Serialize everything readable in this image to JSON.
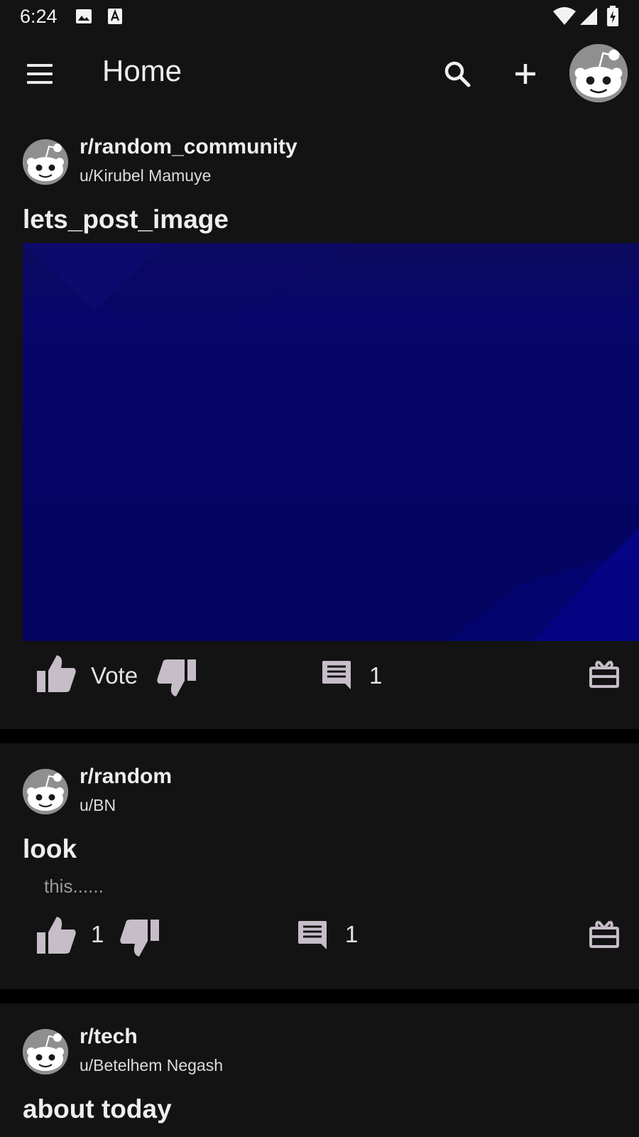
{
  "status_bar": {
    "time": "6:24"
  },
  "app_bar": {
    "title": "Home",
    "menu_icon": "hamburger-menu-icon",
    "search_icon": "search-icon",
    "create_icon": "plus-icon",
    "profile_icon": "reddit-avatar-icon"
  },
  "posts": [
    {
      "subreddit": "r/random_community",
      "user": "u/Kirubel Mamuye",
      "title": "lets_post_image",
      "has_image": true,
      "vote_label": "Vote",
      "comments": "1"
    },
    {
      "subreddit": "r/random",
      "user": "u/BN",
      "title": "look",
      "body": "this......",
      "vote_label": "1",
      "comments": "1"
    },
    {
      "subreddit": "r/tech",
      "user": "u/Betelhem Negash",
      "title": "about today"
    }
  ],
  "colors": {
    "background": "#000000",
    "card": "#131313",
    "icon": "#c6bdc8",
    "image_blue": "#040564"
  }
}
